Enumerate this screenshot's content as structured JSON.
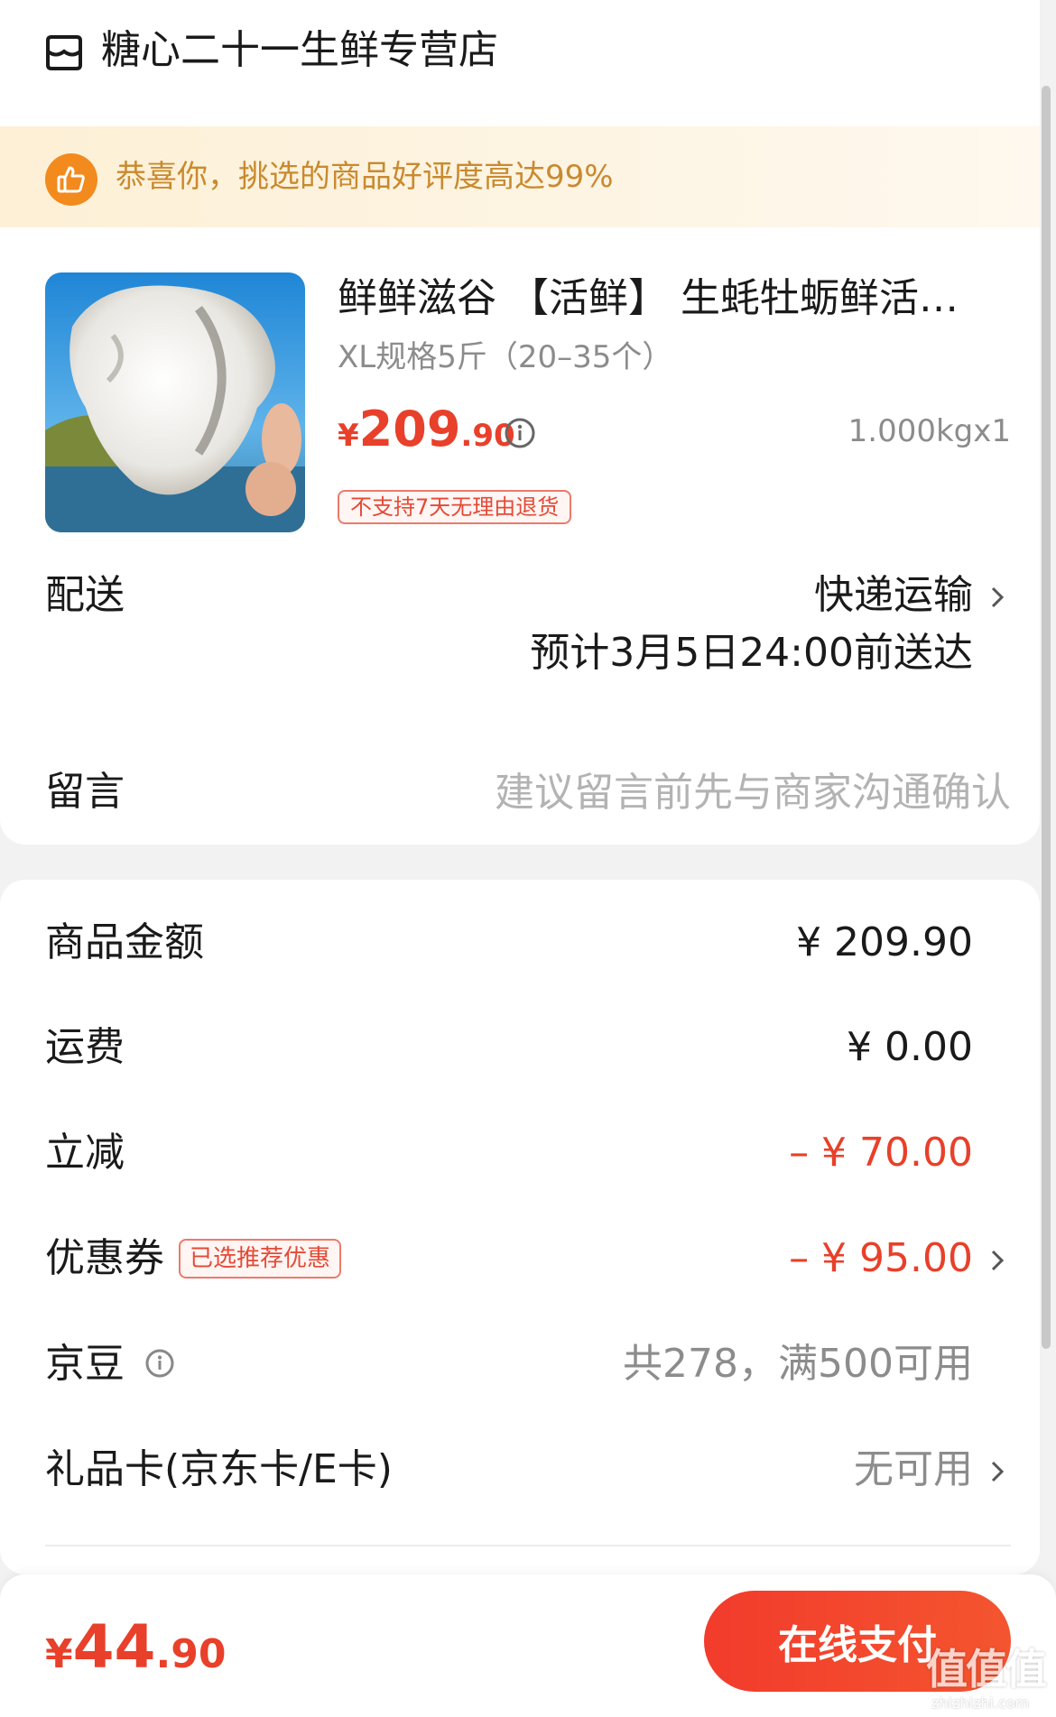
{
  "shop": {
    "name": "糖心二十一生鲜专营店"
  },
  "banner": {
    "text": "恭喜你，挑选的商品好评度高达99%"
  },
  "product": {
    "title": "鲜鲜滋谷 【活鲜】 生蚝牡蛎鲜活…",
    "spec": "XL规格5斤（20–35个）",
    "price_currency": "¥",
    "price_integer": "209",
    "price_decimal": ".90",
    "weight": "1.000kgx1",
    "return_policy": "不支持7天无理由退货"
  },
  "delivery": {
    "label": "配送",
    "method": "快递运输",
    "eta": "预计3月5日24:00前送达"
  },
  "message": {
    "label": "留言",
    "placeholder": "建议留言前先与商家沟通确认",
    "value": ""
  },
  "summary": {
    "goods_amount_label": "商品金额",
    "goods_amount_value": "¥ 209.90",
    "shipping_label": "运费",
    "shipping_value": "¥ 0.00",
    "discount_label": "立减",
    "discount_value": "– ¥ 70.00",
    "coupon_label": "优惠券",
    "coupon_badge": "已选推荐优惠",
    "coupon_value": "– ¥ 95.00",
    "jingdou_label": "京豆",
    "jingdou_value": "共278，满500可用",
    "giftcard_label": "礼品卡(京东卡/E卡)",
    "giftcard_value": "无可用"
  },
  "footer": {
    "total_currency": "¥",
    "total_integer": "44",
    "total_decimal": ".90",
    "pay_label": "在线支付"
  },
  "watermark": {
    "text": "值值值",
    "sub": "zhizhizhi.com"
  },
  "colors": {
    "accent_red": "#e8402a",
    "banner_orange": "#f28a1e",
    "banner_text": "#c98a2e"
  },
  "icons": {
    "store": "store-icon",
    "thumb": "thumbs-up-icon",
    "info": "info-circle-icon",
    "chevron": "chevron-right-icon"
  }
}
